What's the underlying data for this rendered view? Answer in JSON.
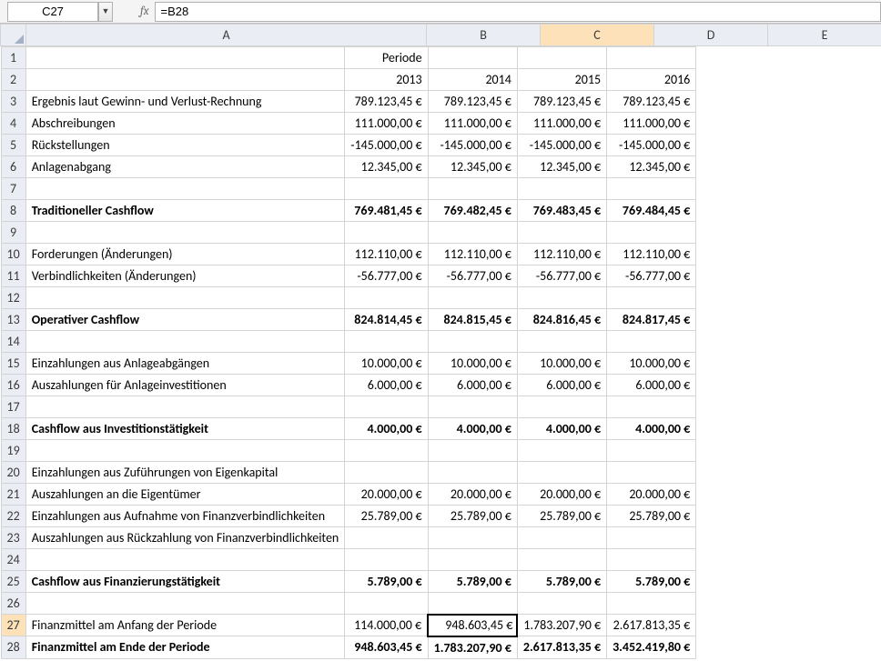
{
  "namebox": {
    "value": "C27"
  },
  "fx_label": "fx",
  "formula_input": {
    "value": "=B28"
  },
  "col_headers": [
    "A",
    "B",
    "C",
    "D",
    "E"
  ],
  "selected_col_index": 2,
  "selected_row_index": 26,
  "rows": [
    "1",
    "2",
    "3",
    "4",
    "5",
    "6",
    "7",
    "8",
    "9",
    "10",
    "11",
    "12",
    "13",
    "14",
    "15",
    "16",
    "17",
    "18",
    "19",
    "20",
    "21",
    "22",
    "23",
    "24",
    "25",
    "26",
    "27",
    "28"
  ],
  "chart_data": {
    "type": "table",
    "categories": [
      2013,
      2014,
      2015,
      2016
    ],
    "series": [
      {
        "name": "Ergebnis laut Gewinn- und Verlust-Rechnung",
        "values": [
          789123.45,
          789123.45,
          789123.45,
          789123.45
        ]
      },
      {
        "name": "Abschreibungen",
        "values": [
          111000.0,
          111000.0,
          111000.0,
          111000.0
        ]
      },
      {
        "name": "Rückstellungen",
        "values": [
          -145000.0,
          -145000.0,
          -145000.0,
          -145000.0
        ]
      },
      {
        "name": "Anlagenabgang",
        "values": [
          12345.0,
          12345.0,
          12345.0,
          12345.0
        ]
      },
      {
        "name": "Traditioneller Cashflow",
        "values": [
          769481.45,
          769482.45,
          769483.45,
          769484.45
        ]
      },
      {
        "name": "Forderungen (Änderungen)",
        "values": [
          112110.0,
          112110.0,
          112110.0,
          112110.0
        ]
      },
      {
        "name": "Verbindlichkeiten (Änderungen)",
        "values": [
          -56777.0,
          -56777.0,
          -56777.0,
          -56777.0
        ]
      },
      {
        "name": "Operativer Cashflow",
        "values": [
          824814.45,
          824815.45,
          824816.45,
          824817.45
        ]
      },
      {
        "name": "Einzahlungen aus Anlageabgängen",
        "values": [
          10000.0,
          10000.0,
          10000.0,
          10000.0
        ]
      },
      {
        "name": "Auszahlungen für Anlageinvestitionen",
        "values": [
          6000.0,
          6000.0,
          6000.0,
          6000.0
        ]
      },
      {
        "name": "Cashflow aus Investitionstätigkeit",
        "values": [
          4000.0,
          4000.0,
          4000.0,
          4000.0
        ]
      },
      {
        "name": "Auszahlungen an die Eigentümer",
        "values": [
          20000.0,
          20000.0,
          20000.0,
          20000.0
        ]
      },
      {
        "name": "Einzahlungen aus Aufnahme von Finanzverbindlichkeiten",
        "values": [
          25789.0,
          25789.0,
          25789.0,
          25789.0
        ]
      },
      {
        "name": "Cashflow aus Finanzierungstätigkeit",
        "values": [
          5789.0,
          5789.0,
          5789.0,
          5789.0
        ]
      },
      {
        "name": "Finanzmittel am Anfang der Periode",
        "values": [
          114000.0,
          948603.45,
          1783207.9,
          2617813.35
        ]
      },
      {
        "name": "Finanzmittel am Ende der Periode",
        "values": [
          948603.45,
          1783207.9,
          2617813.35,
          3452419.8
        ]
      }
    ]
  },
  "cells": {
    "r1": {
      "A": "",
      "B": "Periode",
      "C": "",
      "D": "",
      "E": ""
    },
    "r2": {
      "A": "",
      "B": "2013",
      "C": "2014",
      "D": "2015",
      "E": "2016",
      "align": "right"
    },
    "r3": {
      "A": "Ergebnis laut Gewinn- und Verlust-Rechnung",
      "B": "789.123,45 €",
      "C": "789.123,45 €",
      "D": "789.123,45 €",
      "E": "789.123,45 €"
    },
    "r4": {
      "A": "Abschreibungen",
      "B": "111.000,00 €",
      "C": "111.000,00 €",
      "D": "111.000,00 €",
      "E": "111.000,00 €"
    },
    "r5": {
      "A": "Rückstellungen",
      "B": "-145.000,00 €",
      "C": "-145.000,00 €",
      "D": "-145.000,00 €",
      "E": "-145.000,00 €"
    },
    "r6": {
      "A": "Anlagenabgang",
      "B": "12.345,00 €",
      "C": "12.345,00 €",
      "D": "12.345,00 €",
      "E": "12.345,00 €"
    },
    "r7": {
      "A": "",
      "B": "",
      "C": "",
      "D": "",
      "E": ""
    },
    "r8": {
      "A": "Traditioneller Cashflow",
      "B": "769.481,45 €",
      "C": "769.482,45 €",
      "D": "769.483,45 €",
      "E": "769.484,45 €",
      "bold": true
    },
    "r9": {
      "A": "",
      "B": "",
      "C": "",
      "D": "",
      "E": ""
    },
    "r10": {
      "A": "Forderungen (Änderungen)",
      "B": "112.110,00 €",
      "C": "112.110,00 €",
      "D": "112.110,00 €",
      "E": "112.110,00 €"
    },
    "r11": {
      "A": "Verbindlichkeiten (Änderungen)",
      "B": "-56.777,00 €",
      "C": "-56.777,00 €",
      "D": "-56.777,00 €",
      "E": "-56.777,00 €"
    },
    "r12": {
      "A": "",
      "B": "",
      "C": "",
      "D": "",
      "E": ""
    },
    "r13": {
      "A": "Operativer Cashflow",
      "B": "824.814,45 €",
      "C": "824.815,45 €",
      "D": "824.816,45 €",
      "E": "824.817,45 €",
      "bold": true
    },
    "r14": {
      "A": "",
      "B": "",
      "C": "",
      "D": "",
      "E": ""
    },
    "r15": {
      "A": "Einzahlungen aus Anlageabgängen",
      "B": "10.000,00 €",
      "C": "10.000,00 €",
      "D": "10.000,00 €",
      "E": "10.000,00 €"
    },
    "r16": {
      "A": "Auszahlungen für Anlageinvestitionen",
      "B": "6.000,00 €",
      "C": "6.000,00 €",
      "D": "6.000,00 €",
      "E": "6.000,00 €"
    },
    "r17": {
      "A": "",
      "B": "",
      "C": "",
      "D": "",
      "E": ""
    },
    "r18": {
      "A": "Cashflow aus Investitionstätigkeit",
      "B": "4.000,00 €",
      "C": "4.000,00 €",
      "D": "4.000,00 €",
      "E": "4.000,00 €",
      "bold": true
    },
    "r19": {
      "A": "",
      "B": "",
      "C": "",
      "D": "",
      "E": ""
    },
    "r20": {
      "A": "Einzahlungen aus Zuführungen von Eigenkapital",
      "B": "",
      "C": "",
      "D": "",
      "E": ""
    },
    "r21": {
      "A": "Auszahlungen an die Eigentümer",
      "B": "20.000,00 €",
      "C": "20.000,00 €",
      "D": "20.000,00 €",
      "E": "20.000,00 €"
    },
    "r22": {
      "A": "Einzahlungen aus Aufnahme von Finanzverbindlichkeiten",
      "B": "25.789,00 €",
      "C": "25.789,00 €",
      "D": "25.789,00 €",
      "E": "25.789,00 €"
    },
    "r23": {
      "A": "Auszahlungen aus Rückzahlung von Finanzverbindlichkeiten",
      "B": "",
      "C": "",
      "D": "",
      "E": ""
    },
    "r24": {
      "A": "",
      "B": "",
      "C": "",
      "D": "",
      "E": ""
    },
    "r25": {
      "A": "Cashflow aus Finanzierungstätigkeit",
      "B": "5.789,00 €",
      "C": "5.789,00 €",
      "D": "5.789,00 €",
      "E": "5.789,00 €",
      "bold": true
    },
    "r26": {
      "A": "",
      "B": "",
      "C": "",
      "D": "",
      "E": ""
    },
    "r27": {
      "A": "Finanzmittel am Anfang der Periode",
      "B": "114.000,00 €",
      "C": "948.603,45 €",
      "D": "1.783.207,90 €",
      "E": "2.617.813,35 €",
      "active": "C"
    },
    "r28": {
      "A": "Finanzmittel am Ende der Periode",
      "B": "948.603,45 €",
      "C": "1.783.207,90 €",
      "D": "2.617.813,35 €",
      "E": "3.452.419,80 €",
      "bold": true
    }
  }
}
